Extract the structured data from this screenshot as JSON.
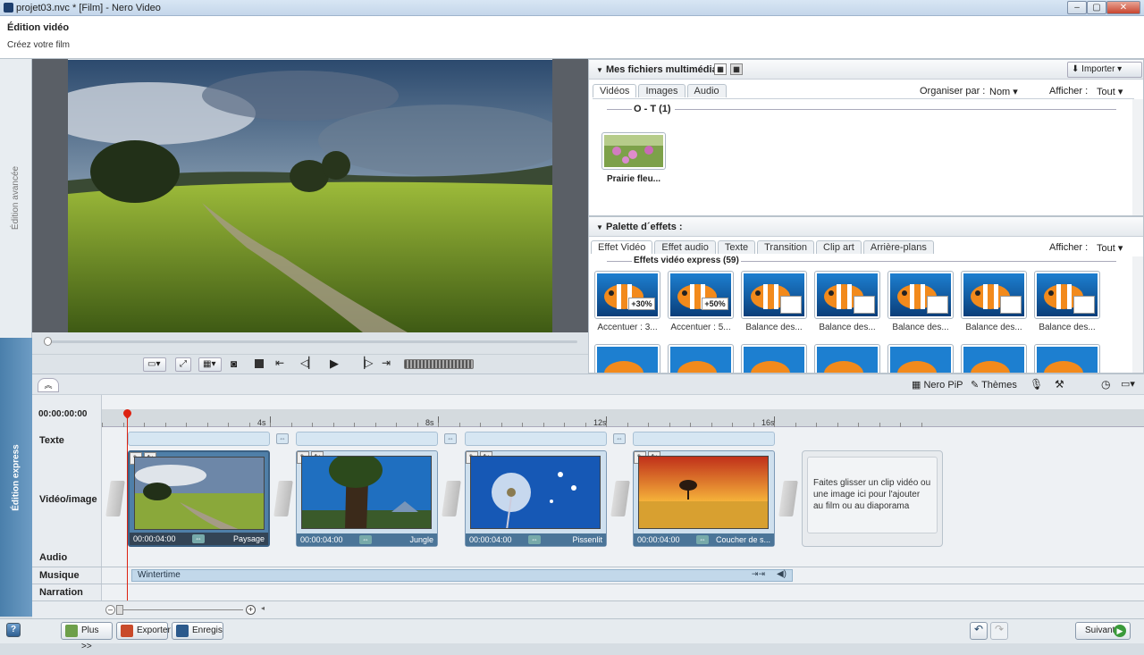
{
  "window": {
    "title": "projet03.nvc * [Film] - Nero Video"
  },
  "header": {
    "title": "Édition vidéo",
    "subtitle": "Créez votre film"
  },
  "left_rail": {
    "advanced_label": "Édition avancée",
    "express_label": "Édition express"
  },
  "media_panel": {
    "title": "Mes fichiers multimédias",
    "import_label": "Importer",
    "tabs": [
      "Vidéos",
      "Images",
      "Audio"
    ],
    "sort_label": "Organiser par :",
    "sort_value": "Nom",
    "show_label": "Afficher :",
    "show_value": "Tout",
    "group_label": "O - T (1)",
    "items": [
      {
        "label": "Prairie fleu..."
      }
    ]
  },
  "effects_panel": {
    "title": "Palette d´effets :",
    "tabs": [
      "Effet Vidéo",
      "Effet audio",
      "Texte",
      "Transition",
      "Clip art",
      "Arrière-plans"
    ],
    "show_label": "Afficher :",
    "show_value": "Tout",
    "group_label": "Effets vidéo express (59)",
    "items": [
      {
        "label": "Accentuer : 3...",
        "badge": "+30%"
      },
      {
        "label": "Accentuer : 5...",
        "badge": "+50%"
      },
      {
        "label": "Balance des..."
      },
      {
        "label": "Balance des..."
      },
      {
        "label": "Balance des..."
      },
      {
        "label": "Balance des..."
      },
      {
        "label": "Balance des..."
      }
    ]
  },
  "timeline_toolbar": {
    "pip_label": "Nero PiP",
    "themes_label": "Thèmes"
  },
  "timeline": {
    "timecode": "00:00:00:00",
    "ticks": [
      "4s",
      "8s",
      "12s",
      "16s"
    ],
    "tracks": [
      "Texte",
      "Vidéo/image",
      "Audio",
      "Musique",
      "Narration"
    ],
    "clips": [
      {
        "time": "00:00:04:00",
        "name": "Paysage"
      },
      {
        "time": "00:00:04:00",
        "name": "Jungle"
      },
      {
        "time": "00:00:04:00",
        "name": "Pissenlit"
      },
      {
        "time": "00:00:04:00",
        "name": "Coucher de s..."
      }
    ],
    "drop_hint": "Faites glisser un clip vidéo ou une image ici pour l'ajouter au film ou au diaporama",
    "music_label": "Wintertime"
  },
  "bottom": {
    "more_label": "Plus >>",
    "export_label": "Exporter",
    "save_label": "Enregistrer",
    "next_label": "Suivant"
  }
}
